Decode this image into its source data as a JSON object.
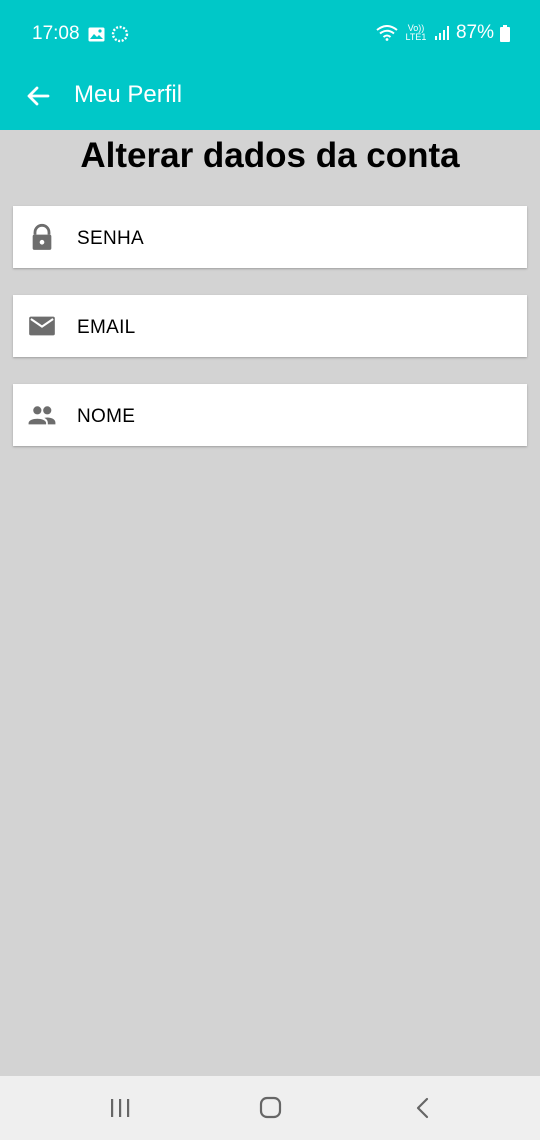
{
  "status_bar": {
    "time": "17:08",
    "battery_percent": "87%",
    "network_label": "Vo)) LTE1",
    "icons": [
      "image-icon",
      "sync-icon",
      "wifi-icon",
      "signal-icon",
      "battery-icon"
    ]
  },
  "app_bar": {
    "title": "Meu Perfil",
    "back_icon": "arrow-left-icon"
  },
  "page": {
    "title": "Alterar dados da conta"
  },
  "menu": {
    "items": [
      {
        "label": "SENHA",
        "icon": "lock-icon"
      },
      {
        "label": "EMAIL",
        "icon": "mail-icon"
      },
      {
        "label": "NOME",
        "icon": "people-icon"
      }
    ]
  },
  "nav_bar": {
    "buttons": [
      "recent-apps-icon",
      "home-icon",
      "back-icon"
    ]
  },
  "colors": {
    "accent": "#00c8c8",
    "background": "#d3d3d3",
    "card": "#ffffff",
    "icon": "#6d6d6d"
  }
}
